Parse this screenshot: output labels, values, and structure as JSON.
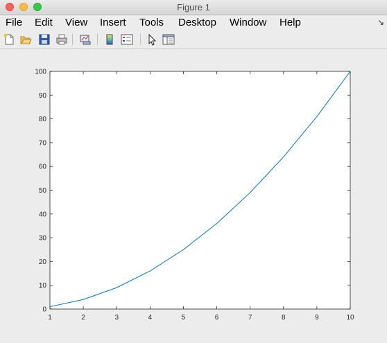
{
  "window": {
    "title": "Figure 1"
  },
  "menu": {
    "items": [
      "File",
      "Edit",
      "View",
      "Insert",
      "Tools",
      "Desktop",
      "Window",
      "Help"
    ]
  },
  "toolbar": {
    "icons": [
      "new-figure-icon",
      "open-file-icon",
      "save-icon",
      "print-icon",
      "link-plot-icon",
      "colorbar-icon",
      "legend-icon",
      "pointer-icon",
      "property-editor-icon"
    ]
  },
  "chart_data": {
    "type": "line",
    "x": [
      1,
      2,
      3,
      4,
      5,
      6,
      7,
      8,
      9,
      10
    ],
    "series": [
      {
        "values": [
          1,
          4,
          9,
          16,
          25,
          36,
          49,
          64,
          81,
          100
        ],
        "color": "#0072bd"
      }
    ],
    "title": "",
    "xlabel": "",
    "ylabel": "",
    "xlim": [
      1,
      10
    ],
    "ylim": [
      0,
      100
    ],
    "xticks": [
      1,
      2,
      3,
      4,
      5,
      6,
      7,
      8,
      9,
      10
    ],
    "yticks": [
      0,
      10,
      20,
      30,
      40,
      50,
      60,
      70,
      80,
      90,
      100
    ],
    "grid": false
  }
}
